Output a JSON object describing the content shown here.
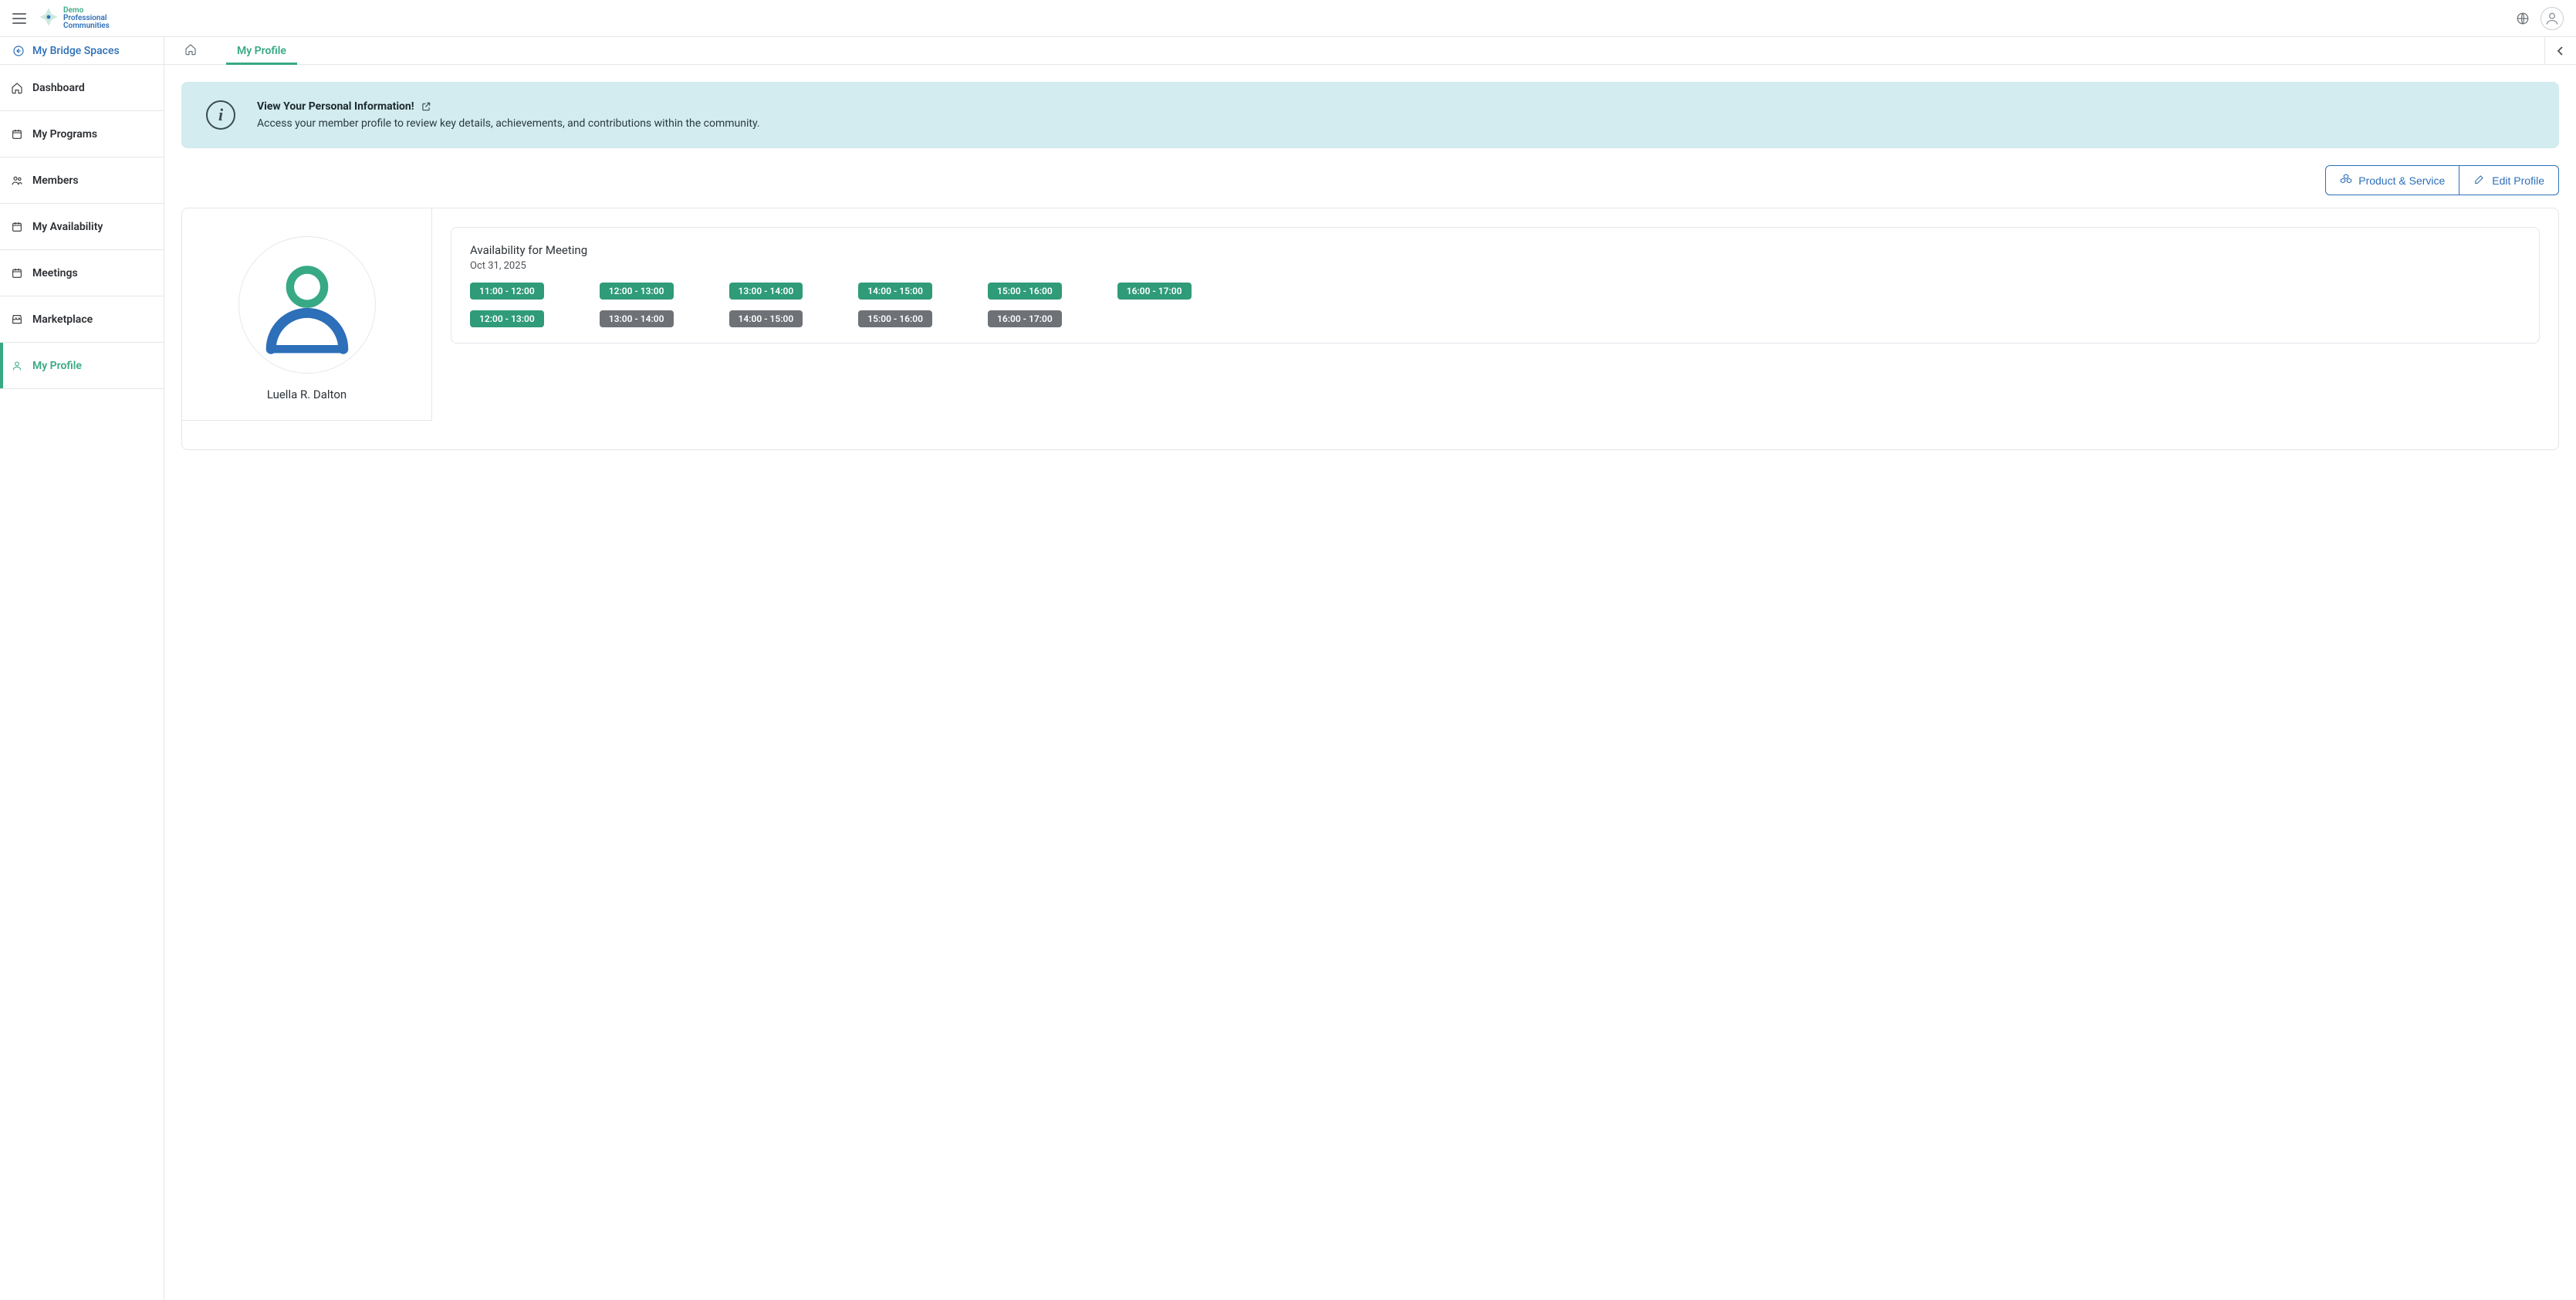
{
  "header": {
    "logo_line1": "Demo",
    "logo_line2": "Professional",
    "logo_line3": "Communities"
  },
  "sidebar": {
    "back_label": "My Bridge Spaces",
    "items": [
      {
        "label": "Dashboard",
        "icon": "home"
      },
      {
        "label": "My Programs",
        "icon": "calendar"
      },
      {
        "label": "Members",
        "icon": "users"
      },
      {
        "label": "My Availability",
        "icon": "calendar"
      },
      {
        "label": "Meetings",
        "icon": "calendar"
      },
      {
        "label": "Marketplace",
        "icon": "store"
      },
      {
        "label": "My Profile",
        "icon": "user",
        "active": true
      }
    ]
  },
  "breadcrumb": {
    "current": "My Profile"
  },
  "info": {
    "title": "View Your Personal Information!",
    "body": "Access your member profile to review key details, achievements, and contributions within the community."
  },
  "actions": {
    "product_service": "Product & Service",
    "edit_profile": "Edit Profile"
  },
  "profile": {
    "name": "Luella R. Dalton"
  },
  "availability": {
    "title": "Availability for Meeting",
    "date": "Oct 31, 2025",
    "slots": [
      {
        "label": "11:00 - 12:00",
        "status": "available"
      },
      {
        "label": "12:00 - 13:00",
        "status": "available"
      },
      {
        "label": "13:00 - 14:00",
        "status": "available"
      },
      {
        "label": "14:00 - 15:00",
        "status": "available"
      },
      {
        "label": "15:00 - 16:00",
        "status": "available"
      },
      {
        "label": "16:00 - 17:00",
        "status": "available"
      },
      {
        "label": "12:00 - 13:00",
        "status": "available"
      },
      {
        "label": "13:00 - 14:00",
        "status": "unavailable"
      },
      {
        "label": "14:00 - 15:00",
        "status": "unavailable"
      },
      {
        "label": "15:00 - 16:00",
        "status": "unavailable"
      },
      {
        "label": "16:00 - 17:00",
        "status": "unavailable"
      }
    ]
  }
}
